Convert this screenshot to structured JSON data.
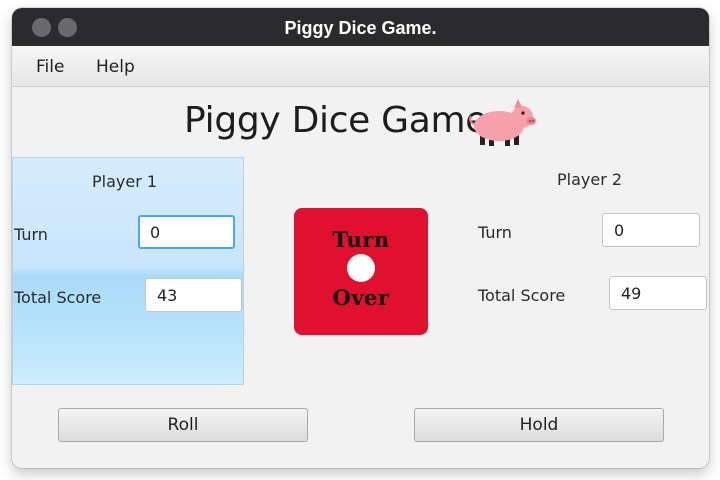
{
  "window": {
    "title": "Piggy Dice Game."
  },
  "menu": {
    "file": "File",
    "help": "Help"
  },
  "header": {
    "title": "Piggy Dice Game",
    "pig_icon": "pig-icon"
  },
  "player1": {
    "heading": "Player 1",
    "turn_label": "Turn",
    "turn_value": "0",
    "total_label": "Total Score",
    "total_value": "43"
  },
  "player2": {
    "heading": "Player 2",
    "turn_label": "Turn",
    "turn_value": "0",
    "total_label": "Total Score",
    "total_value": "49"
  },
  "die": {
    "line1": "Turn",
    "line2": "Over",
    "color": "#e0102f"
  },
  "buttons": {
    "roll": "Roll",
    "hold": "Hold"
  }
}
